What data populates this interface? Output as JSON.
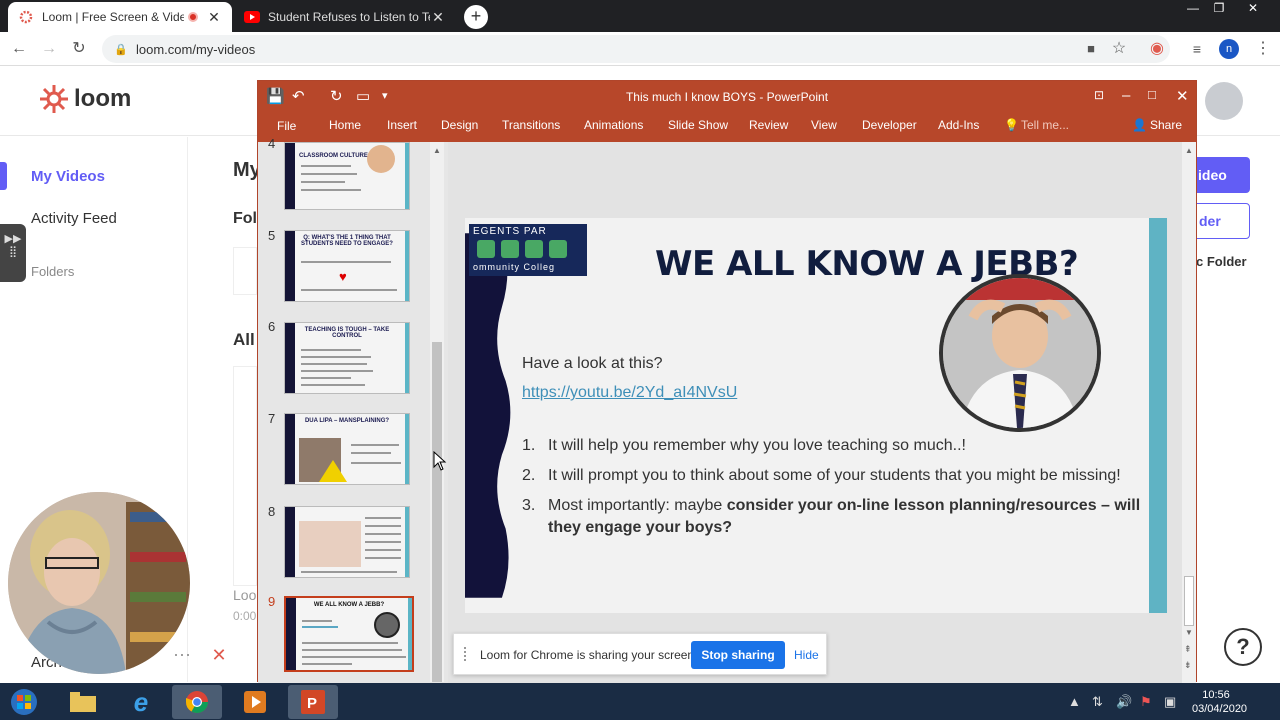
{
  "browser": {
    "tabs": [
      {
        "title": "Loom | Free Screen & Video"
      },
      {
        "title": "Student Refuses to Listen to Teac"
      }
    ],
    "url": "loom.com/my-videos",
    "profile_initial": "n"
  },
  "loom": {
    "brand": "loom",
    "sidebar": {
      "my_videos": "My Videos",
      "activity_feed": "Activity Feed",
      "folders": "Folders",
      "archive_fragment": "Arch"
    },
    "main_fragments": {
      "my": "My",
      "fol": "Fol",
      "all": "All",
      "loo": "Loo",
      "time": "0:00"
    },
    "buttons": {
      "new_video_fragment": "ideo",
      "new_folder_fragment": "der",
      "c_folder_fragment": "c Folder"
    },
    "help": "?"
  },
  "ppt": {
    "title": "This much I know BOYS - PowerPoint",
    "ribbon_tabs": [
      "File",
      "Home",
      "Insert",
      "Design",
      "Transitions",
      "Animations",
      "Slide Show",
      "Review",
      "View",
      "Developer",
      "Add-Ins"
    ],
    "tell_me": "Tell me...",
    "share": "Share",
    "thumbnails": [
      {
        "num": "4",
        "title": "CLASSROOM CULTURE"
      },
      {
        "num": "5",
        "title": "Q: WHAT'S THE 1 THING THAT STUDENTS NEED TO ENGAGE?"
      },
      {
        "num": "6",
        "title": "TEACHING IS TOUGH – TAKE CONTROL"
      },
      {
        "num": "7",
        "title": "DUA LIPA – MANSPLAINING?"
      },
      {
        "num": "8",
        "title": ""
      },
      {
        "num": "9",
        "title": "WE ALL KNOW A JEBB?"
      }
    ],
    "slide": {
      "logo_top": "EGENTS PAR",
      "logo_bottom": "ommunity Colleg",
      "title": "WE ALL KNOW A JEBB?",
      "intro": "Have a look at this?",
      "link": "https://youtu.be/2Yd_aI4NVsU",
      "items": [
        {
          "num": "1.",
          "text": "It will help you remember why you love teaching so much..!"
        },
        {
          "num": "2.",
          "text": "It will prompt you to think about some of your students that you might be missing!"
        },
        {
          "num": "3.",
          "text_plain": "Most importantly:  maybe ",
          "text_bold": "consider your on-line lesson planning/resources – will they engage your boys?"
        }
      ]
    }
  },
  "share_bar": {
    "message": "Loom for Chrome is sharing your screen.",
    "stop": "Stop sharing",
    "hide": "Hide"
  },
  "taskbar": {
    "time": "10:56",
    "date": "03/04/2020"
  },
  "colors": {
    "ppt_accent": "#b7472a",
    "loom_purple": "#625df5",
    "chrome_dark": "#202124"
  }
}
